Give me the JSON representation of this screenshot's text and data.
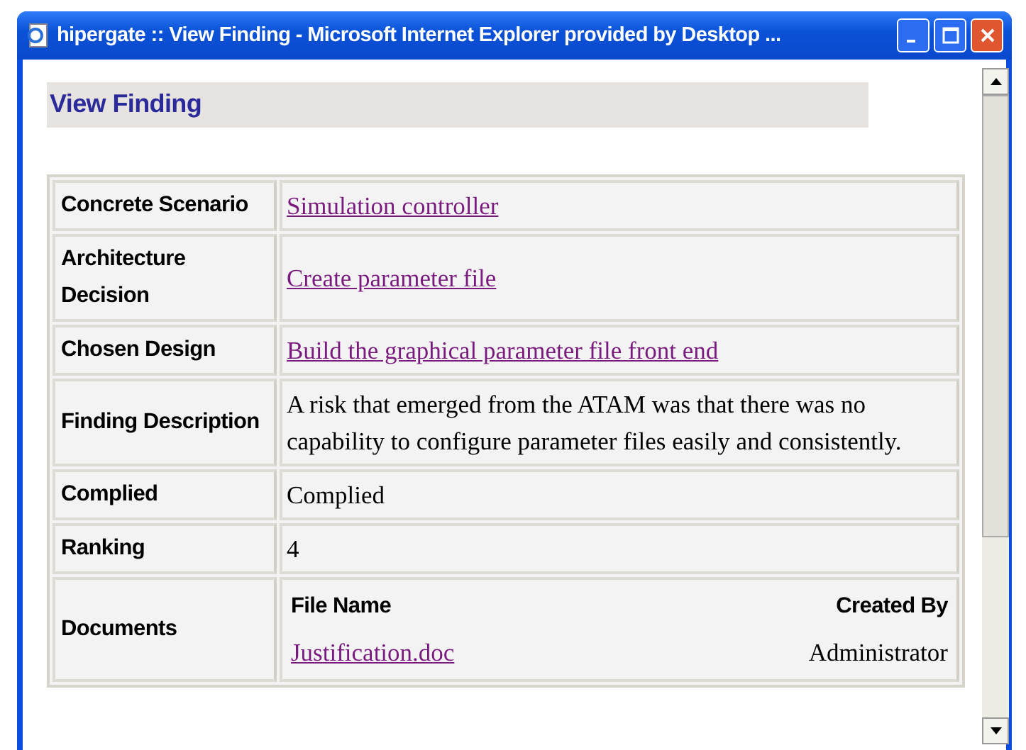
{
  "window": {
    "title": "hipergate :: View Finding - Microsoft Internet Explorer provided by Desktop ..."
  },
  "heading": "View Finding",
  "rows": [
    {
      "label": "Concrete Scenario",
      "kind": "link",
      "value": "Simulation controller"
    },
    {
      "label": "Architecture Decision",
      "kind": "link",
      "value": "Create parameter file"
    },
    {
      "label": "Chosen Design",
      "kind": "link",
      "value": "Build the graphical parameter file front end"
    },
    {
      "label": "Finding Description",
      "kind": "text",
      "value": "A risk that emerged from the ATAM was that there was no capability to configure parameter files easily and consistently."
    },
    {
      "label": "Complied",
      "kind": "text",
      "value": "Complied"
    },
    {
      "label": "Ranking",
      "kind": "text",
      "value": "4"
    },
    {
      "label": "Documents",
      "kind": "documents",
      "columns": [
        "File Name",
        "Created By"
      ],
      "files": [
        {
          "name": "Justification.doc",
          "created_by": "Administrator"
        }
      ]
    }
  ]
}
